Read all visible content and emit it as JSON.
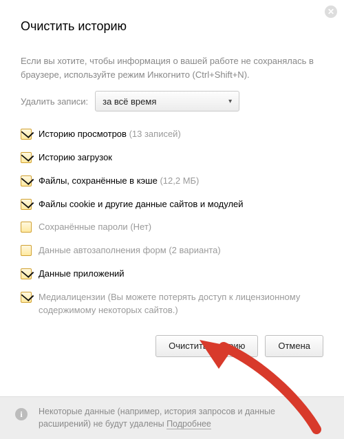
{
  "title": "Очистить историю",
  "intro": "Если вы хотите, чтобы информация о вашей работе не сохранялась в браузере, используйте режим Инкогнито (Ctrl+Shift+N).",
  "period_label": "Удалить записи:",
  "period_value": "за всё время",
  "options": [
    {
      "checked": true,
      "strong": true,
      "label": "Историю просмотров",
      "hint": "(13 записей)"
    },
    {
      "checked": true,
      "strong": true,
      "label": "Историю загрузок",
      "hint": ""
    },
    {
      "checked": true,
      "strong": true,
      "label": "Файлы, сохранённые в кэше",
      "hint": "(12,2 МБ)"
    },
    {
      "checked": true,
      "strong": true,
      "label": "Файлы cookie и другие данные сайтов и модулей",
      "hint": ""
    },
    {
      "checked": false,
      "strong": false,
      "label": "Сохранённые пароли",
      "hint": "(Нет)"
    },
    {
      "checked": false,
      "strong": false,
      "label": "Данные автозаполнения форм",
      "hint": "(2 варианта)"
    },
    {
      "checked": true,
      "strong": true,
      "label": "Данные приложений",
      "hint": ""
    },
    {
      "checked": true,
      "strong": false,
      "label": "Медиалицензии",
      "hint": "(Вы можете потерять доступ к лицензионному содержимому некоторых сайтов.)"
    }
  ],
  "buttons": {
    "clear": "Очистить историю",
    "cancel": "Отмена"
  },
  "footer_text": "Некоторые данные (например, история запросов и данные расширений) не будут удалены ",
  "footer_more": "Подробнее",
  "colors": {
    "arrow": "#d83a2b"
  }
}
